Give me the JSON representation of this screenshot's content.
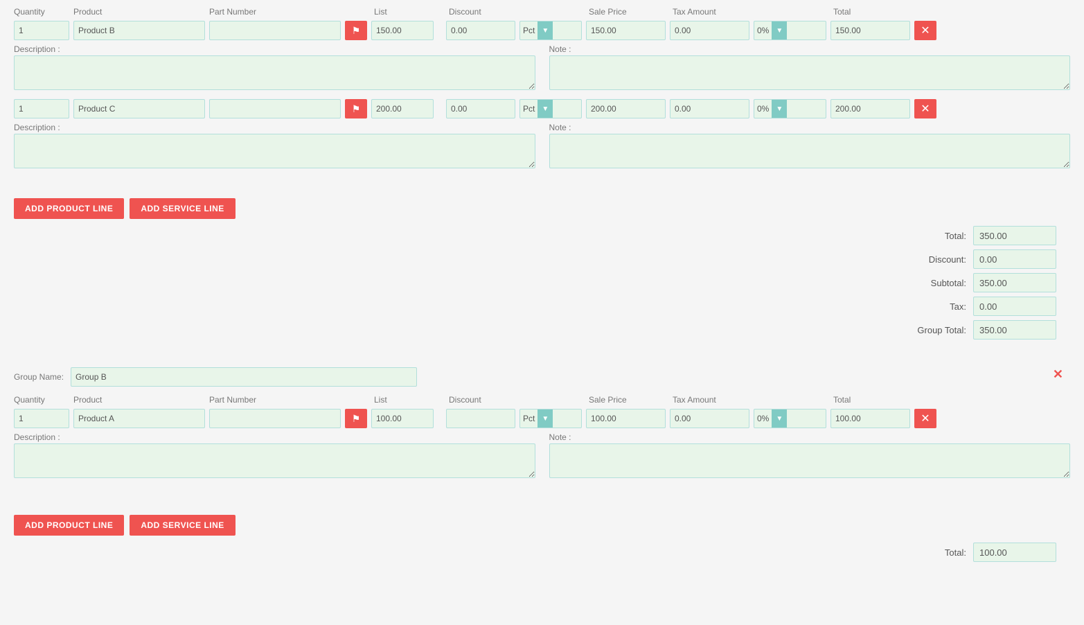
{
  "group_a": {
    "lines": [
      {
        "qty": "1",
        "product": "Product B",
        "part_number": "",
        "list": "150.00",
        "discount": "0.00",
        "pct": "Pct",
        "sale_price": "150.00",
        "tax_amount": "0.00",
        "tax_pct": "0%",
        "total": "150.00",
        "description": "",
        "note": ""
      },
      {
        "qty": "1",
        "product": "Product C",
        "part_number": "",
        "list": "200.00",
        "discount": "0.00",
        "pct": "Pct",
        "sale_price": "200.00",
        "tax_amount": "0.00",
        "tax_pct": "0%",
        "total": "200.00",
        "description": "",
        "note": ""
      }
    ],
    "add_product_label": "ADD PRODUCT LINE",
    "add_service_label": "ADD SERVICE LINE",
    "totals": {
      "total_label": "Total:",
      "total_value": "350.00",
      "discount_label": "Discount:",
      "discount_value": "0.00",
      "subtotal_label": "Subtotal:",
      "subtotal_value": "350.00",
      "tax_label": "Tax:",
      "tax_value": "0.00",
      "group_total_label": "Group Total:",
      "group_total_value": "350.00"
    }
  },
  "group_b": {
    "name": "Group B",
    "name_label": "Group Name:",
    "lines": [
      {
        "qty": "1",
        "product": "Product A",
        "part_number": "",
        "list": "100.00",
        "discount": "",
        "pct": "Pct",
        "sale_price": "100.00",
        "tax_amount": "0.00",
        "tax_pct": "0%",
        "total": "100.00",
        "description": "",
        "note": ""
      }
    ],
    "add_product_label": "ADD PRODUCT LINE",
    "add_service_label": "ADD SERVICE LINE",
    "totals": {
      "total_label": "Total:",
      "total_value": "100.00"
    }
  },
  "col_headers": {
    "quantity": "Quantity",
    "product": "Product",
    "part_number": "Part Number",
    "list": "List",
    "discount": "Discount",
    "sale_price": "Sale Price",
    "tax_amount": "Tax Amount",
    "total": "Total"
  }
}
